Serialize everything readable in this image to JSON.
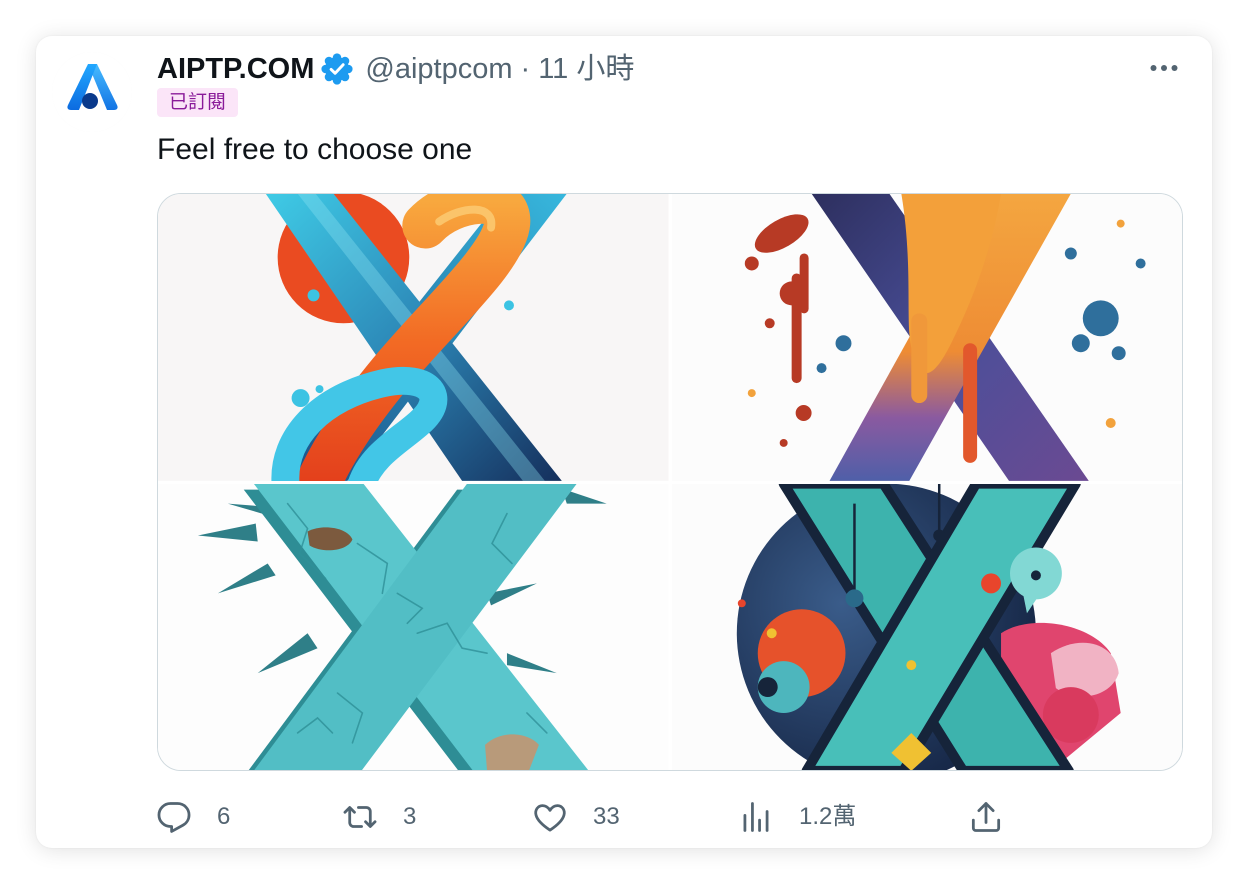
{
  "tweet": {
    "author": {
      "avatar_icon": "aiptp-logo-icon",
      "display_name": "AIPTP.COM",
      "verified_icon": "verified-badge-icon",
      "handle": "@aiptpcom",
      "separator": "·",
      "time": "11 小時",
      "subscribed_badge": "已訂閱"
    },
    "more_icon": "more-options-icon",
    "text": "Feel free to choose one",
    "actions": {
      "reply": {
        "icon": "reply-icon",
        "count": "6"
      },
      "retweet": {
        "icon": "retweet-icon",
        "count": "3"
      },
      "like": {
        "icon": "like-icon",
        "count": "33"
      },
      "views": {
        "icon": "views-icon",
        "count": "1.2萬"
      },
      "share": {
        "icon": "share-icon"
      }
    }
  },
  "colors": {
    "text_primary": "#0f1419",
    "text_secondary": "#536471",
    "verified_blue": "#1d9bf0",
    "badge_background": "#fbe5f8",
    "badge_text": "#8a1a99",
    "media_border": "#cfd9de"
  }
}
